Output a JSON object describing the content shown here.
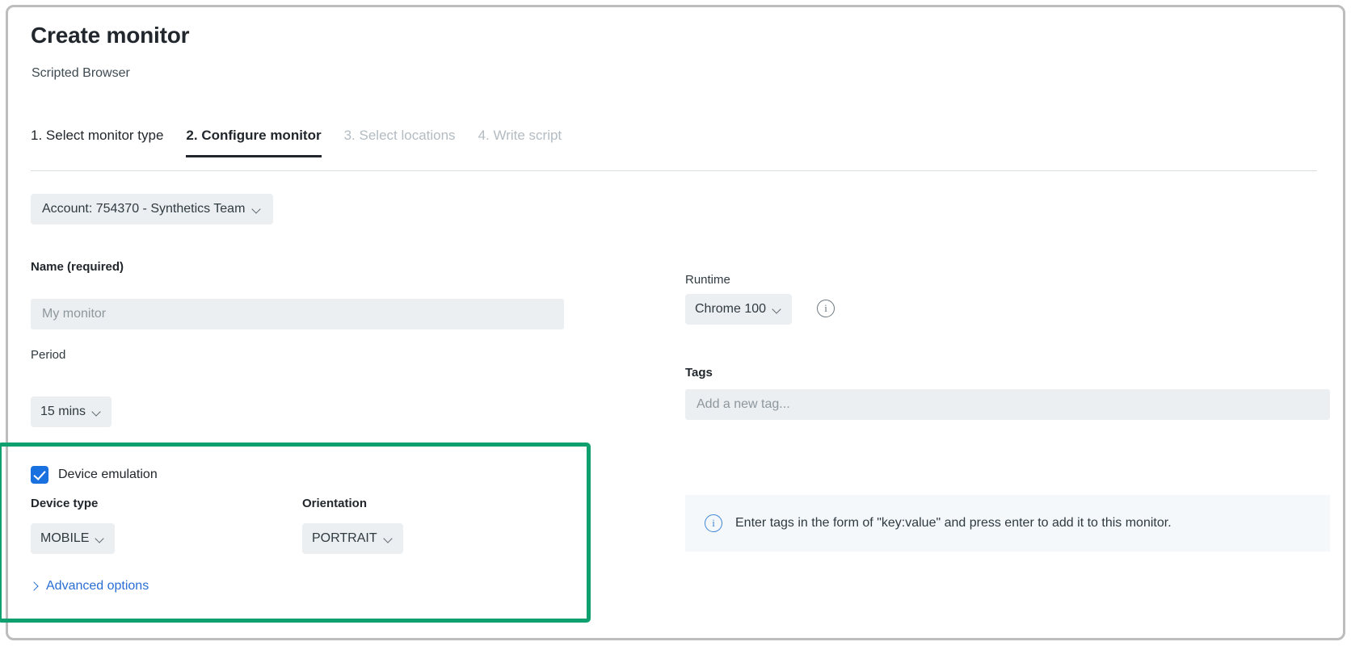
{
  "window": {
    "title": "Create monitor",
    "subtitle": "Scripted Browser"
  },
  "tabs": [
    {
      "label": "1. Select monitor type",
      "state": "complete"
    },
    {
      "label": "2. Configure monitor",
      "state": "active"
    },
    {
      "label": "3. Select locations",
      "state": "disabled"
    },
    {
      "label": "4. Write script",
      "state": "disabled"
    }
  ],
  "account": {
    "label": "Account: 754370 - Synthetics Team",
    "icon": "chevron-down-icon"
  },
  "left_column": {
    "name_field": {
      "label": "Name (required)",
      "value": "",
      "placeholder": "My monitor"
    },
    "period_field": {
      "label": "Period",
      "value": "15 mins",
      "icon": "chevron-down-icon"
    },
    "device_emulation": {
      "checkbox_label": "Device emulation",
      "checked": true,
      "device_type": {
        "label": "Device type",
        "value": "MOBILE",
        "icon": "chevron-down-icon"
      },
      "orientation": {
        "label": "Orientation",
        "value": "PORTRAIT",
        "icon": "chevron-down-icon"
      }
    },
    "advanced_options": {
      "label": "Advanced options",
      "icon": "chevron-right-icon"
    }
  },
  "right_column": {
    "runtime_field": {
      "label": "Runtime",
      "value": "Chrome 100",
      "icon": "chevron-down-icon",
      "info_icon": "info-icon",
      "info_glyph": "i"
    },
    "tags_field": {
      "label": "Tags",
      "value": "",
      "placeholder": "Add a new tag..."
    },
    "info_banner": {
      "icon": "info-icon",
      "glyph": "i",
      "text": "Enter tags in the form of \"key:value\" and press enter to add it to this monitor."
    }
  },
  "colors": {
    "highlight_border": "#0ea06e",
    "checkbox_accent": "#1971e0",
    "link": "#2a6ed4",
    "banner_bg": "#f4f8fa"
  }
}
